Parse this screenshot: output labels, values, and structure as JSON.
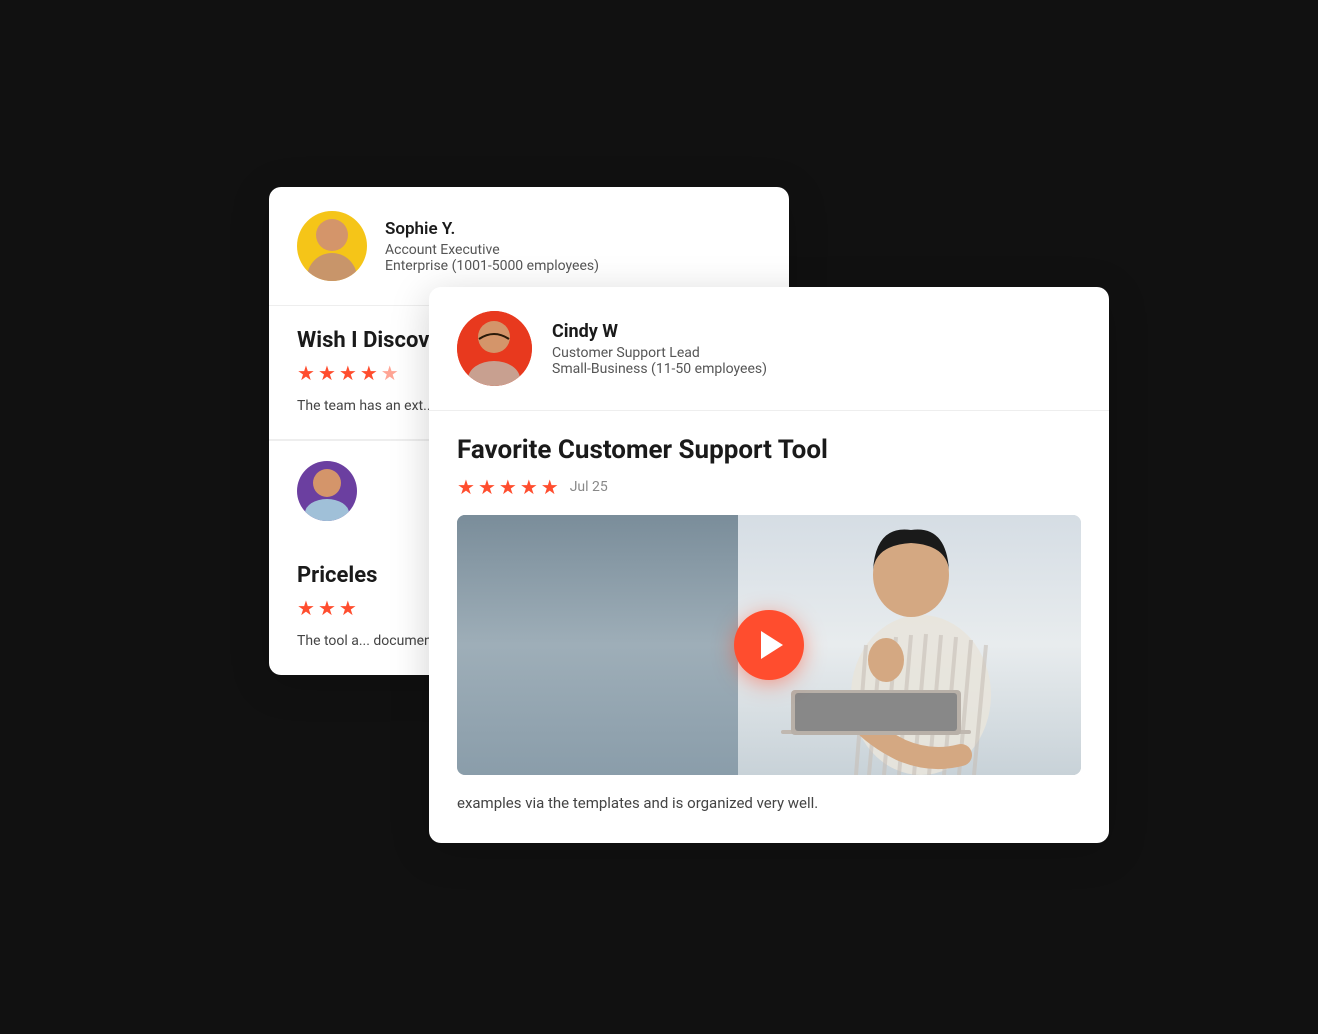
{
  "cards": {
    "back": {
      "reviewer1": {
        "name": "Sophie Y.",
        "role": "Account Executive",
        "company": "Enterprise (1001-5000 employees)"
      },
      "review1": {
        "title": "Wish I Discover",
        "stars": 4.5,
        "text": "The team has an ext... Service Management... have a"
      },
      "reviewer2": {
        "name": "",
        "role": "",
        "company": ""
      },
      "review2": {
        "title": "Priceles",
        "stars": 3,
        "text": "The tool a... document..."
      }
    },
    "front": {
      "reviewer": {
        "name": "Cindy W",
        "role": "Customer Support Lead",
        "company": "Small-Business (11-50 employees)"
      },
      "review": {
        "title": "Favorite Customer Support Tool",
        "stars": 5,
        "date": "Jul 25",
        "bottom_text": "examples via the templates and is organized very well."
      }
    }
  },
  "ui": {
    "play_button_label": "Play video",
    "star_char": "★"
  }
}
